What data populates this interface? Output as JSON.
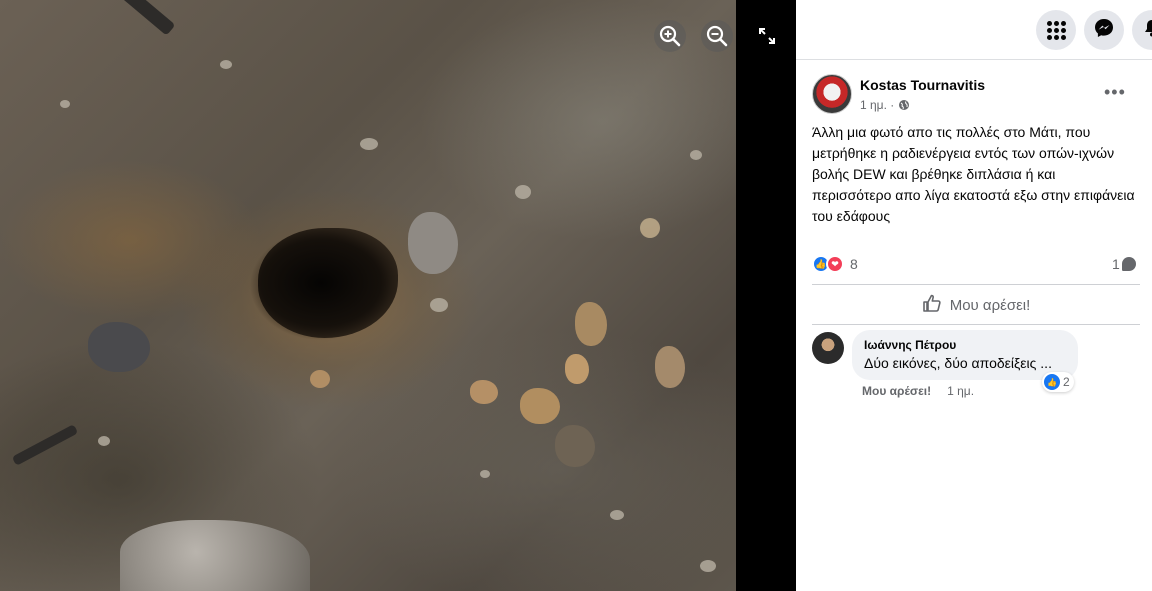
{
  "viewer": {
    "zoom_in_icon": "zoom-in-icon",
    "zoom_out_icon": "zoom-out-icon",
    "expand_icon": "expand-icon"
  },
  "top_bar": {
    "icons": [
      "menu-grid-icon",
      "messenger-icon",
      "notifications-icon"
    ]
  },
  "post": {
    "author": "Kostas Tournavitis",
    "time": "1 ημ. ·",
    "privacy_icon": "globe-icon",
    "more_label": "•••",
    "text": "Άλλη μια φωτό απο τις πολλές στο Μάτι, που μετρήθηκε η ραδιενέργεια εντός των οπών-ιχνών βολής DEW και βρέθηκε διπλάσια ή και περισσότερο απο λίγα εκατοστά εξω στην επιφάνεια του εδάφους",
    "reaction_count": "8",
    "comment_count": "1",
    "like_action_label": "Μου αρέσει!"
  },
  "comment": {
    "author": "Ιωάννης Πέτρου",
    "text": "Δύο εικόνες, δύο αποδείξεις ...",
    "reaction_count": "2",
    "like_label": "Μου αρέσει!",
    "time": "1 ημ."
  },
  "colors": {
    "facebook_blue": "#1877f2",
    "love_red": "#f33e58",
    "muted_text": "#65676b",
    "comment_bg": "#f0f2f5"
  }
}
